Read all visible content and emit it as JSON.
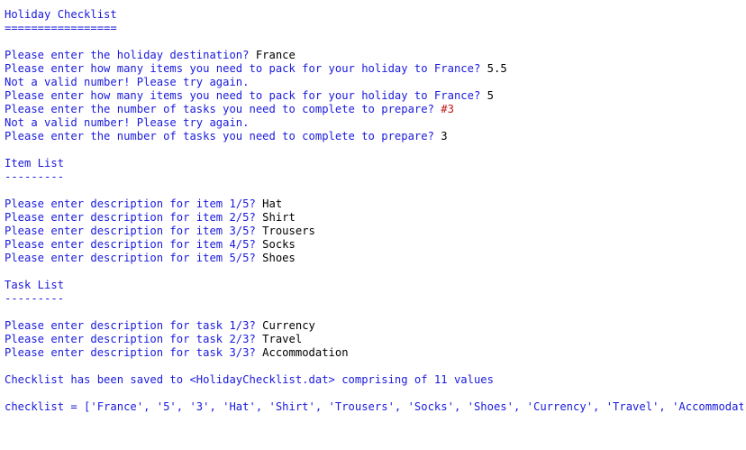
{
  "colors": {
    "output": "#1a1adb",
    "user_input": "#000000",
    "error_input": "#c41818",
    "prompt": "#c41818"
  },
  "shell_lines": [
    {
      "parts": [
        {
          "t": "",
          "c": "blue"
        }
      ]
    },
    {
      "parts": [
        {
          "t": "Holiday Checklist",
          "c": "blue"
        }
      ]
    },
    {
      "parts": [
        {
          "t": "=================",
          "c": "blue"
        }
      ]
    },
    {
      "parts": [
        {
          "t": "",
          "c": "blue"
        }
      ]
    },
    {
      "parts": [
        {
          "t": "Please enter the holiday destination? ",
          "c": "blue"
        },
        {
          "t": "France",
          "c": "black"
        }
      ]
    },
    {
      "parts": [
        {
          "t": "Please enter how many items you need to pack for your holiday to France? ",
          "c": "blue"
        },
        {
          "t": "5.5",
          "c": "black"
        }
      ]
    },
    {
      "parts": [
        {
          "t": "Not a valid number! Please try again.",
          "c": "blue"
        }
      ]
    },
    {
      "parts": [
        {
          "t": "Please enter how many items you need to pack for your holiday to France? ",
          "c": "blue"
        },
        {
          "t": "5",
          "c": "black"
        }
      ]
    },
    {
      "parts": [
        {
          "t": "Please enter the number of tasks you need to complete to prepare? ",
          "c": "blue"
        },
        {
          "t": "#3",
          "c": "red"
        }
      ]
    },
    {
      "parts": [
        {
          "t": "Not a valid number! Please try again.",
          "c": "blue"
        }
      ]
    },
    {
      "parts": [
        {
          "t": "Please enter the number of tasks you need to complete to prepare? ",
          "c": "blue"
        },
        {
          "t": "3",
          "c": "black"
        }
      ]
    },
    {
      "parts": [
        {
          "t": "",
          "c": "blue"
        }
      ]
    },
    {
      "parts": [
        {
          "t": "Item List",
          "c": "blue"
        }
      ]
    },
    {
      "parts": [
        {
          "t": "---------",
          "c": "blue"
        }
      ]
    },
    {
      "parts": [
        {
          "t": "",
          "c": "blue"
        }
      ]
    },
    {
      "parts": [
        {
          "t": "Please enter description for item 1/5? ",
          "c": "blue"
        },
        {
          "t": "Hat",
          "c": "black"
        }
      ]
    },
    {
      "parts": [
        {
          "t": "Please enter description for item 2/5? ",
          "c": "blue"
        },
        {
          "t": "Shirt",
          "c": "black"
        }
      ]
    },
    {
      "parts": [
        {
          "t": "Please enter description for item 3/5? ",
          "c": "blue"
        },
        {
          "t": "Trousers",
          "c": "black"
        }
      ]
    },
    {
      "parts": [
        {
          "t": "Please enter description for item 4/5? ",
          "c": "blue"
        },
        {
          "t": "Socks",
          "c": "black"
        }
      ]
    },
    {
      "parts": [
        {
          "t": "Please enter description for item 5/5? ",
          "c": "blue"
        },
        {
          "t": "Shoes",
          "c": "black"
        }
      ]
    },
    {
      "parts": [
        {
          "t": "",
          "c": "blue"
        }
      ]
    },
    {
      "parts": [
        {
          "t": "Task List",
          "c": "blue"
        }
      ]
    },
    {
      "parts": [
        {
          "t": "---------",
          "c": "blue"
        }
      ]
    },
    {
      "parts": [
        {
          "t": "",
          "c": "blue"
        }
      ]
    },
    {
      "parts": [
        {
          "t": "Please enter description for task 1/3? ",
          "c": "blue"
        },
        {
          "t": "Currency",
          "c": "black"
        }
      ]
    },
    {
      "parts": [
        {
          "t": "Please enter description for task 2/3? ",
          "c": "blue"
        },
        {
          "t": "Travel",
          "c": "black"
        }
      ]
    },
    {
      "parts": [
        {
          "t": "Please enter description for task 3/3? ",
          "c": "blue"
        },
        {
          "t": "Accommodation",
          "c": "black"
        }
      ]
    },
    {
      "parts": [
        {
          "t": "",
          "c": "blue"
        }
      ]
    },
    {
      "parts": [
        {
          "t": "Checklist has been saved to <HolidayChecklist.dat> comprising of 11 values",
          "c": "blue"
        }
      ]
    },
    {
      "parts": [
        {
          "t": "",
          "c": "blue"
        }
      ]
    },
    {
      "parts": [
        {
          "t": "checklist = ['France', '5', '3', 'Hat', 'Shirt', 'Trousers', 'Socks', 'Shoes', 'Currency', 'Travel', 'Accommodation']",
          "c": "blue"
        }
      ]
    }
  ],
  "prompt": ">>>"
}
